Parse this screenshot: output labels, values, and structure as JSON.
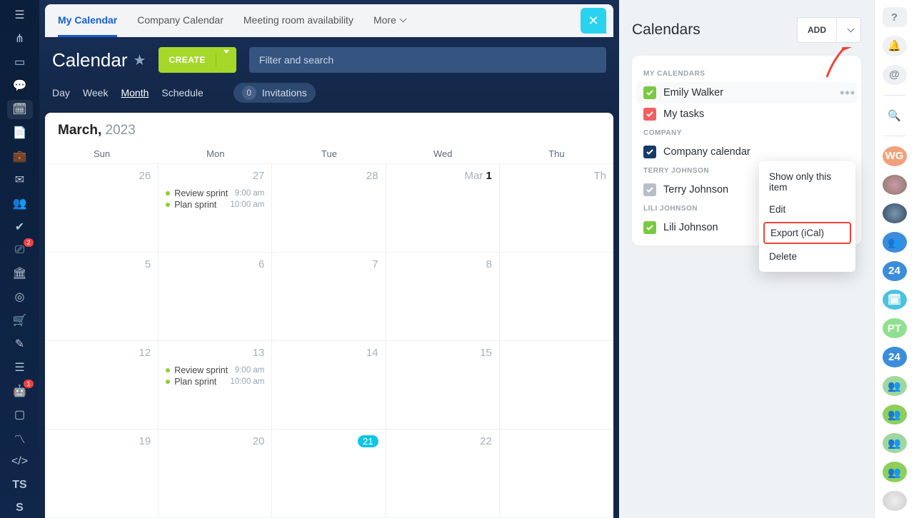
{
  "leftSidebar": {
    "badges": {
      "filter": "2",
      "robot": "1"
    },
    "textItems": [
      "TS",
      "S"
    ]
  },
  "tabs": {
    "t1": "My Calendar",
    "t2": "Company Calendar",
    "t3": "Meeting room availability",
    "more": "More"
  },
  "header": {
    "title": "Calendar",
    "create": "CREATE",
    "searchPlaceholder": "Filter and search"
  },
  "views": {
    "day": "Day",
    "week": "Week",
    "month": "Month",
    "schedule": "Schedule",
    "invitations": "Invitations",
    "invCount": "0"
  },
  "calendar": {
    "month": "March,",
    "year": "2023",
    "dow": [
      "Sun",
      "Mon",
      "Tue",
      "Wed",
      "Thu"
    ],
    "cells": [
      {
        "date": "26"
      },
      {
        "date": "27",
        "events": [
          {
            "t": "Review sprint",
            "time": "9:00 am"
          },
          {
            "t": "Plan sprint",
            "time": "10:00 am"
          }
        ]
      },
      {
        "date": "28"
      },
      {
        "date": "Mar 1",
        "bold": true
      },
      {
        "date": "Th"
      },
      {
        "date": "5"
      },
      {
        "date": "6"
      },
      {
        "date": "7"
      },
      {
        "date": "8"
      },
      {
        "date": ""
      },
      {
        "date": "12"
      },
      {
        "date": "13",
        "events": [
          {
            "t": "Review sprint",
            "time": "9:00 am"
          },
          {
            "t": "Plan sprint",
            "time": "10:00 am"
          }
        ]
      },
      {
        "date": "14"
      },
      {
        "date": "15"
      },
      {
        "date": ""
      },
      {
        "date": "19"
      },
      {
        "date": "20"
      },
      {
        "date": "21",
        "pill": true
      },
      {
        "date": "22"
      },
      {
        "date": ""
      }
    ]
  },
  "panel": {
    "title": "Calendars",
    "add": "ADD",
    "sections": {
      "my": "MY CALENDARS",
      "company": "COMPANY",
      "terry": "TERRY JOHNSON",
      "lili": "LILI JOHNSON"
    },
    "items": {
      "emily": "Emily Walker",
      "tasks": "My tasks",
      "company": "Company calendar",
      "terry": "Terry Johnson",
      "lili": "Lili Johnson"
    }
  },
  "menu": {
    "showOnly": "Show only this item",
    "edit": "Edit",
    "export": "Export (iCal)",
    "delete": "Delete"
  },
  "rail": {
    "wg": "WG",
    "pt": "PT",
    "n24": "24"
  }
}
